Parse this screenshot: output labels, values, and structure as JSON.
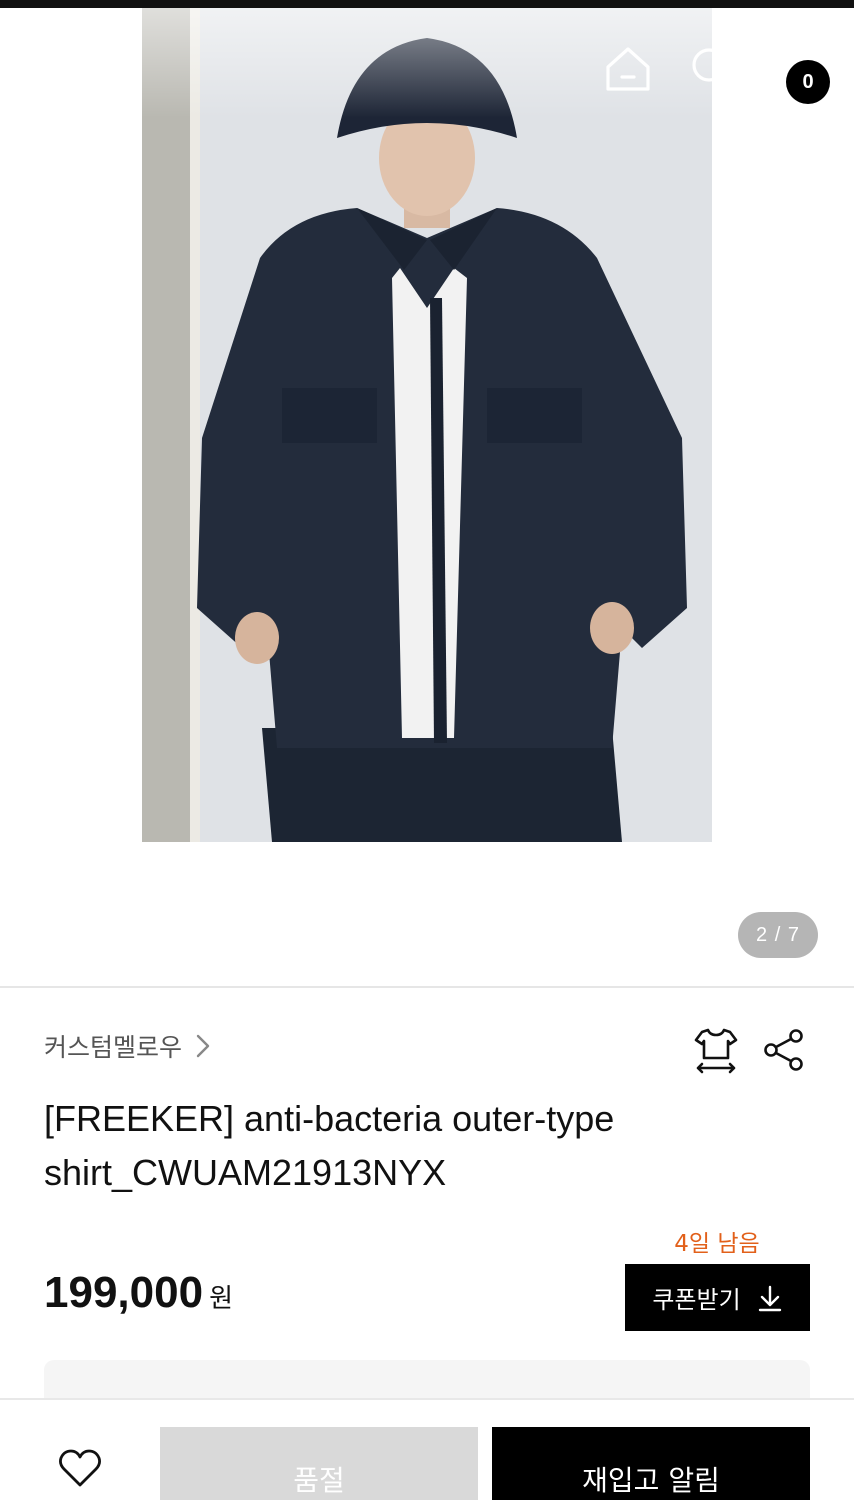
{
  "header": {
    "back_icon": "arrow-left-icon",
    "home_icon": "home-icon",
    "search_icon": "search-icon",
    "cart_icon": "shopping-bag-icon",
    "cart_count": "0"
  },
  "gallery": {
    "pager": "2 / 7",
    "current_index": 2,
    "total": 7
  },
  "product": {
    "brand": "커스텀멜로우",
    "title_line1": "[FREEKER] anti-bacteria outer-type",
    "title_line2": "shirt_CWUAM21913NYX",
    "price": "199,000",
    "price_unit": "원",
    "fit_icon": "size-fit-icon",
    "share_icon": "share-icon"
  },
  "coupon": {
    "deadline": "4일 남음",
    "label": "쿠폰받기",
    "icon": "download-icon"
  },
  "bottom_bar": {
    "like_icon": "heart-icon",
    "soldout_label": "품절",
    "restock_label": "재입고 알림"
  },
  "colors": {
    "accent_deadline": "#e2601a",
    "primary": "#000000",
    "disabled": "#d9d9d9"
  }
}
